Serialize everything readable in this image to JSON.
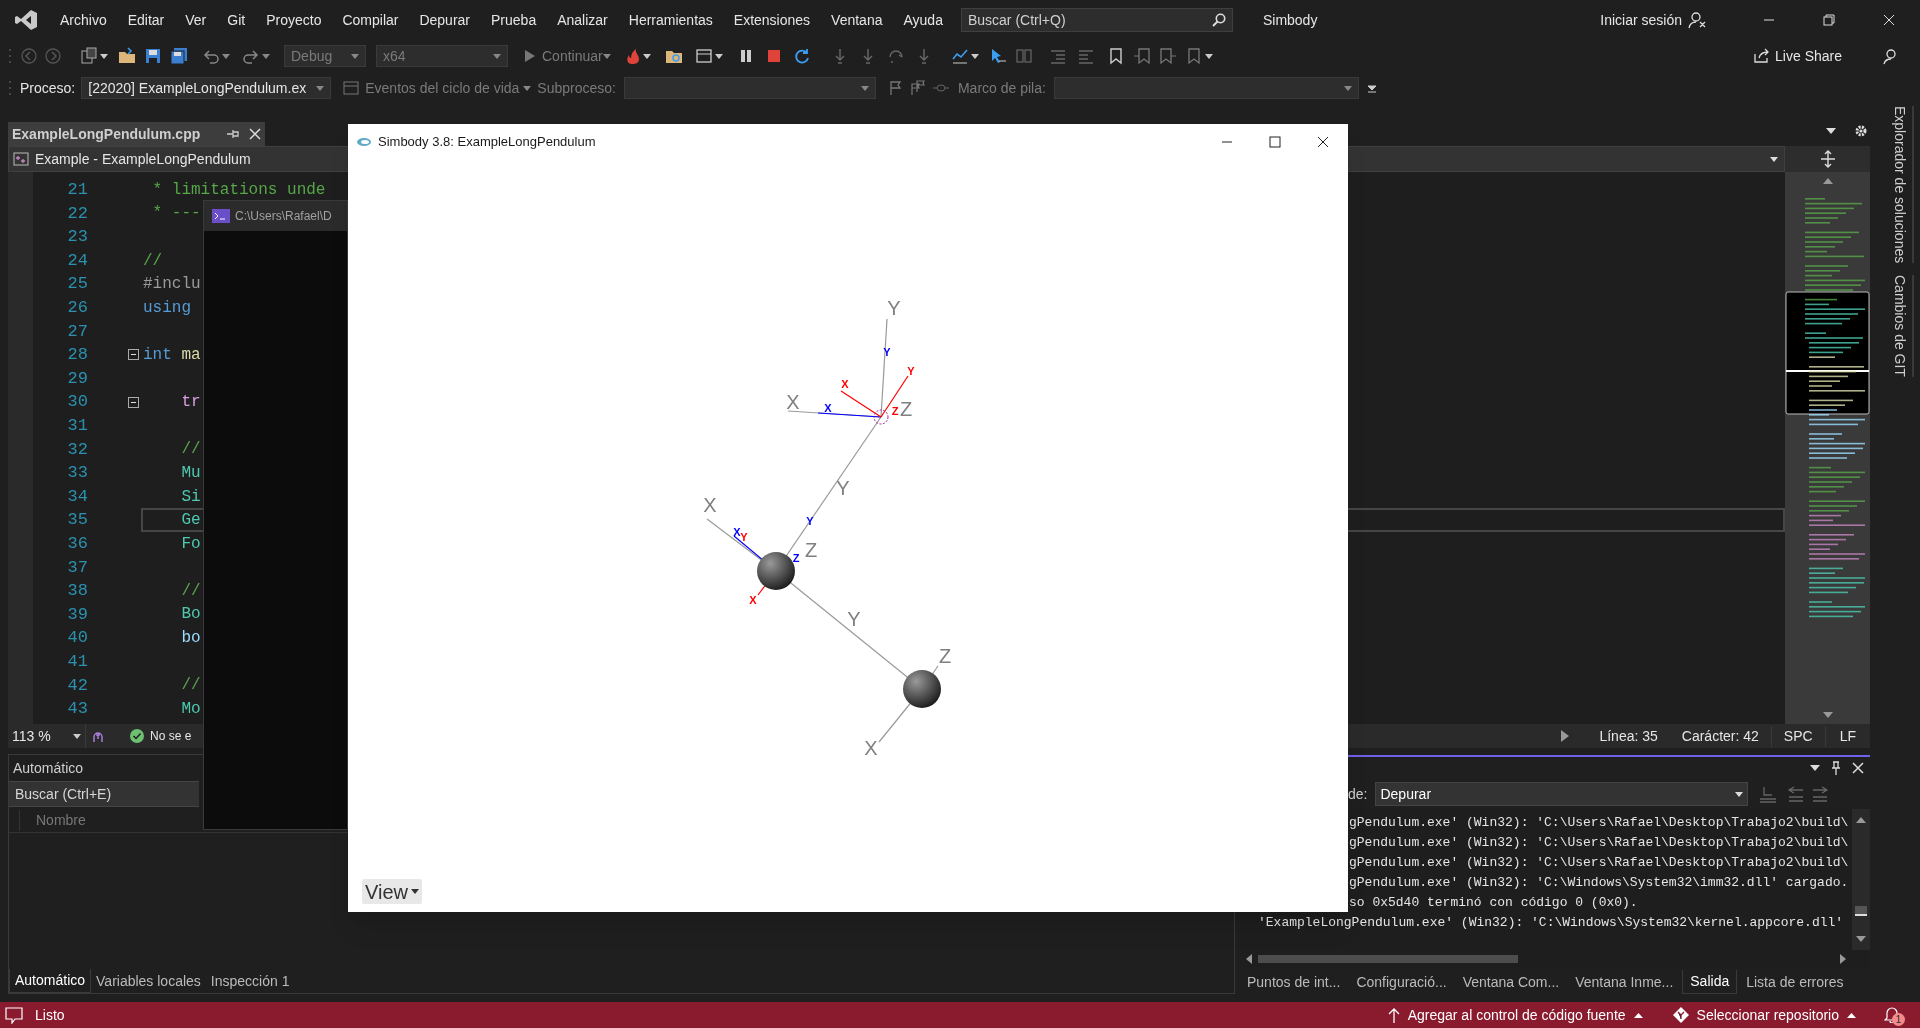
{
  "menu_bar": {
    "items": [
      "Archivo",
      "Editar",
      "Ver",
      "Git",
      "Proyecto",
      "Compilar",
      "Depurar",
      "Prueba",
      "Analizar",
      "Herramientas",
      "Extensiones",
      "Ventana",
      "Ayuda"
    ],
    "search": {
      "placeholder": "Buscar (Ctrl+Q)"
    },
    "solution_name": "Simbody",
    "sign_in": "Iniciar sesión"
  },
  "toolbar": {
    "configuration": "Debug",
    "platform": "x64",
    "continue": "Continuar",
    "live_share": "Live Share"
  },
  "debug_location": {
    "process_label": "Proceso:",
    "process": "[22020] ExampleLongPendulum.ex",
    "lifecycle_events": "Eventos del ciclo de vida",
    "thread_label": "Subproceso:",
    "stack_frame_label": "Marco de pila:"
  },
  "editor": {
    "tab_title": "ExampleLongPendulum.cpp",
    "navigation": "Example - ExampleLongPendulum",
    "lines": [
      {
        "number": "21",
        "current": false,
        "fold": false,
        "tokens": [
          {
            "text": " * limitations unde",
            "kind": "comment"
          }
        ]
      },
      {
        "number": "22",
        "current": false,
        "fold": false,
        "tokens": [
          {
            "text": " * ---",
            "kind": "comment"
          }
        ]
      },
      {
        "number": "23",
        "current": false,
        "fold": false
      },
      {
        "number": "24",
        "current": false,
        "fold": false,
        "tokens": [
          {
            "text": "//",
            "kind": "comment"
          }
        ]
      },
      {
        "number": "25",
        "current": false,
        "fold": false,
        "tokens": [
          {
            "text": "#inclu",
            "kind": "preprocessor"
          }
        ]
      },
      {
        "number": "26",
        "current": false,
        "fold": false,
        "tokens": [
          {
            "text": "using",
            "kind": "keyword"
          }
        ]
      },
      {
        "number": "27",
        "current": false,
        "fold": false
      },
      {
        "number": "28",
        "current": false,
        "fold": true,
        "tokens": [
          {
            "text": "int",
            "kind": "keyword"
          },
          {
            "text": " ma",
            "kind": "function"
          }
        ]
      },
      {
        "number": "29",
        "current": false,
        "fold": false
      },
      {
        "number": "30",
        "current": false,
        "fold": true,
        "tokens": [
          {
            "text": "    tr",
            "kind": "control"
          }
        ]
      },
      {
        "number": "31",
        "current": false,
        "fold": false
      },
      {
        "number": "32",
        "current": false,
        "fold": false,
        "tokens": [
          {
            "text": "    //",
            "kind": "comment"
          }
        ]
      },
      {
        "number": "33",
        "current": false,
        "fold": false,
        "tokens": [
          {
            "text": "    Mu",
            "kind": "type"
          }
        ]
      },
      {
        "number": "34",
        "current": false,
        "fold": false,
        "tokens": [
          {
            "text": "    Si",
            "kind": "type"
          }
        ]
      },
      {
        "number": "35",
        "current": true,
        "fold": false,
        "tokens": [
          {
            "text": "    Ge",
            "kind": "type"
          }
        ]
      },
      {
        "number": "36",
        "current": false,
        "fold": false,
        "tokens": [
          {
            "text": "    Fo",
            "kind": "type"
          }
        ]
      },
      {
        "number": "37",
        "current": false,
        "fold": false
      },
      {
        "number": "38",
        "current": false,
        "fold": false,
        "tokens": [
          {
            "text": "    //",
            "kind": "comment"
          }
        ]
      },
      {
        "number": "39",
        "current": false,
        "fold": false,
        "tokens": [
          {
            "text": "    Bo",
            "kind": "type"
          }
        ]
      },
      {
        "number": "40",
        "current": false,
        "fold": false,
        "tokens": [
          {
            "text": "    bo",
            "kind": "variable"
          }
        ]
      },
      {
        "number": "41",
        "current": false,
        "fold": false
      },
      {
        "number": "42",
        "current": false,
        "fold": false,
        "tokens": [
          {
            "text": "    //",
            "kind": "comment"
          }
        ]
      },
      {
        "number": "43",
        "current": false,
        "fold": false,
        "tokens": [
          {
            "text": "    Mo",
            "kind": "type"
          }
        ]
      }
    ],
    "zoom": "113 %",
    "health": "No se e",
    "line": "Línea: 35",
    "column": "Carácter: 42",
    "whitespace": "SPC",
    "line_ending": "LF"
  },
  "side_tabs": [
    "Explorador de soluciones",
    "Cambios de GIT"
  ],
  "console_window": {
    "title": "C:\\Users\\Rafael\\D"
  },
  "simbody_window": {
    "title": "Simbody 3.8: ExampleLongPendulum",
    "view_menu": "View",
    "labels": [
      {
        "text": "Y",
        "color": "#808080"
      },
      {
        "text": "X",
        "color": "#808080"
      },
      {
        "text": "Z",
        "color": "#808080"
      },
      {
        "text": "Y",
        "color": "#808080"
      },
      {
        "text": "X",
        "color": "#808080"
      },
      {
        "text": "Z",
        "color": "#808080"
      },
      {
        "text": "Y",
        "color": "#808080"
      },
      {
        "text": "Z",
        "color": "#808080"
      },
      {
        "text": "X",
        "color": "#808080"
      },
      {
        "text": "Y",
        "color": "#0000ff"
      },
      {
        "text": "X",
        "color": "#ff0000"
      },
      {
        "text": "Y",
        "color": "#ff0000"
      },
      {
        "text": "X",
        "color": "#0000ff"
      },
      {
        "text": "Z",
        "color": "#ff0000"
      },
      {
        "text": "Y",
        "color": "#0000ff"
      },
      {
        "text": "X",
        "color": "#0000ff"
      },
      {
        "text": "Y",
        "color": "#ff0000"
      },
      {
        "text": "X",
        "color": "#ff0000"
      },
      {
        "text": "Z",
        "color": "#0000ff"
      }
    ]
  },
  "locals_panel": {
    "title": "Automático",
    "search": {
      "placeholder": "Buscar (Ctrl+E)"
    },
    "columns": [
      "Nombre"
    ],
    "tabs": [
      {
        "label": "Automático",
        "selected": true
      },
      {
        "label": "Variables locales",
        "selected": false
      },
      {
        "label": "Inspección 1",
        "selected": false
      }
    ]
  },
  "output_panel": {
    "source_label": "de:",
    "source": "Depurar",
    "lines": [
      {
        "text": "gPendulum.exe' (Win32): 'C:\\Users\\Rafael\\Desktop\\Trabajo2\\build\\",
        "kind": "partial"
      },
      {
        "text": "gPendulum.exe' (Win32): 'C:\\Users\\Rafael\\Desktop\\Trabajo2\\build\\",
        "kind": "partial"
      },
      {
        "text": "gPendulum.exe' (Win32): 'C:\\Users\\Rafael\\Desktop\\Trabajo2\\build\\",
        "kind": "partial"
      },
      {
        "text": "gPendulum.exe' (Win32): 'C:\\Windows\\System32\\imm32.dll' cargado.",
        "kind": "partial"
      },
      {
        "text": "so 0x5d40 terminó con código 0 (0x0).",
        "kind": "partial"
      },
      {
        "text": "'ExampleLongPendulum.exe' (Win32): 'C:\\Windows\\System32\\kernel.appcore.dll'",
        "kind": "full"
      }
    ],
    "tabs": [
      {
        "label": "Puntos de int...",
        "selected": false
      },
      {
        "label": "Configuració...",
        "selected": false
      },
      {
        "label": "Ventana Com...",
        "selected": false
      },
      {
        "label": "Ventana Inme...",
        "selected": false
      },
      {
        "label": "Salida",
        "selected": true
      },
      {
        "label": "Lista de errores",
        "selected": false
      }
    ]
  },
  "status_bar": {
    "text": "Listo",
    "source_control": "Agregar al control de código fuente",
    "repository": "Seleccionar repositorio",
    "notifications": "1"
  }
}
